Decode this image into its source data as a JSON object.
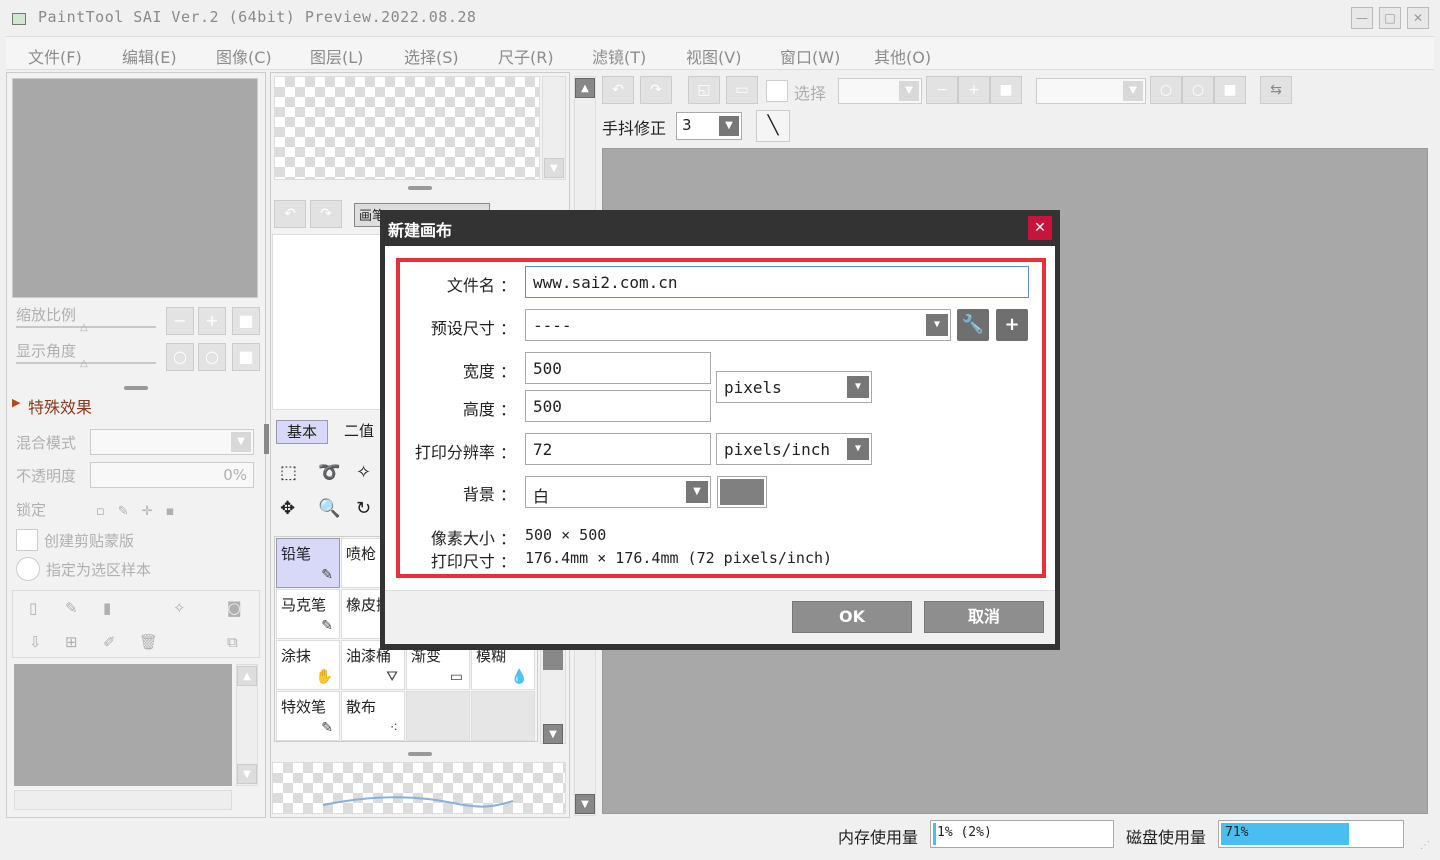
{
  "window": {
    "title": "PaintTool SAI Ver.2 (64bit) Preview.2022.08.28",
    "minimize": "—",
    "maximize": "□",
    "close": "✕"
  },
  "menu": [
    "文件(F)",
    "编辑(E)",
    "图像(C)",
    "图层(L)",
    "选择(S)",
    "尺子(R)",
    "滤镜(T)",
    "视图(V)",
    "窗口(W)",
    "其他(O)"
  ],
  "left_panel": {
    "zoom_label": "缩放比例",
    "rotate_label": "显示角度",
    "effects_label": "特殊效果",
    "blend_mode_label": "混合模式",
    "opacity_label": "不透明度",
    "opacity_value": "0%",
    "lock_label": "锁定",
    "clip_label": "创建剪贴蒙版",
    "selection_sample_label": "指定为选区样本"
  },
  "middle_panel": {
    "canvas_tab": "画笔",
    "tab_basic": "基本",
    "tab_binary": "二值",
    "tools": [
      {
        "label": "铅笔",
        "icon": "pencil-icon"
      },
      {
        "label": "喷枪",
        "icon": "airbrush-icon"
      },
      {
        "label": "马克笔",
        "icon": "marker-icon"
      },
      {
        "label": "橡皮擦",
        "icon": "eraser-icon"
      },
      {
        "label": "涂抹",
        "icon": "smudge-icon"
      },
      {
        "label": "油漆桶",
        "icon": "bucket-icon"
      },
      {
        "label": "渐变",
        "icon": "gradient-icon"
      },
      {
        "label": "模糊",
        "icon": "blur-icon"
      },
      {
        "label": "特效笔",
        "icon": "fx-pen-icon"
      },
      {
        "label": "散布",
        "icon": "scatter-icon"
      }
    ]
  },
  "toolbar": {
    "select_label": "选择",
    "stabilizer_label": "手抖修正",
    "stabilizer_value": "3"
  },
  "status": {
    "memory_label": "内存使用量",
    "memory_value": "1% (2%)",
    "memory_fraction": 0.01,
    "disk_label": "磁盘使用量",
    "disk_value": "71%",
    "disk_fraction": 0.71,
    "disk_color": "#48bff0"
  },
  "dialog": {
    "title": "新建画布",
    "close": "✕",
    "filename_label": "文件名 ：",
    "filename_value": "www.sai2.com.cn",
    "preset_label": "预设尺寸 ：",
    "preset_value": "----",
    "width_label": "宽度 ：",
    "width_value": "500",
    "height_label": "高度 ：",
    "height_value": "500",
    "size_unit": "pixels",
    "resolution_label": "打印分辨率 ：",
    "resolution_value": "72",
    "resolution_unit": "pixels/inch",
    "background_label": "背景 ：",
    "background_value": "白",
    "background_swatch": "#808080",
    "pixel_size_label": "像素大小 ：",
    "pixel_size_value": "500 × 500",
    "print_size_label": "打印尺寸 ：",
    "print_size_value": "176.4mm × 176.4mm (72 pixels/inch)",
    "ok": "OK",
    "cancel": "取消",
    "highlight_color": "#e8303a"
  }
}
